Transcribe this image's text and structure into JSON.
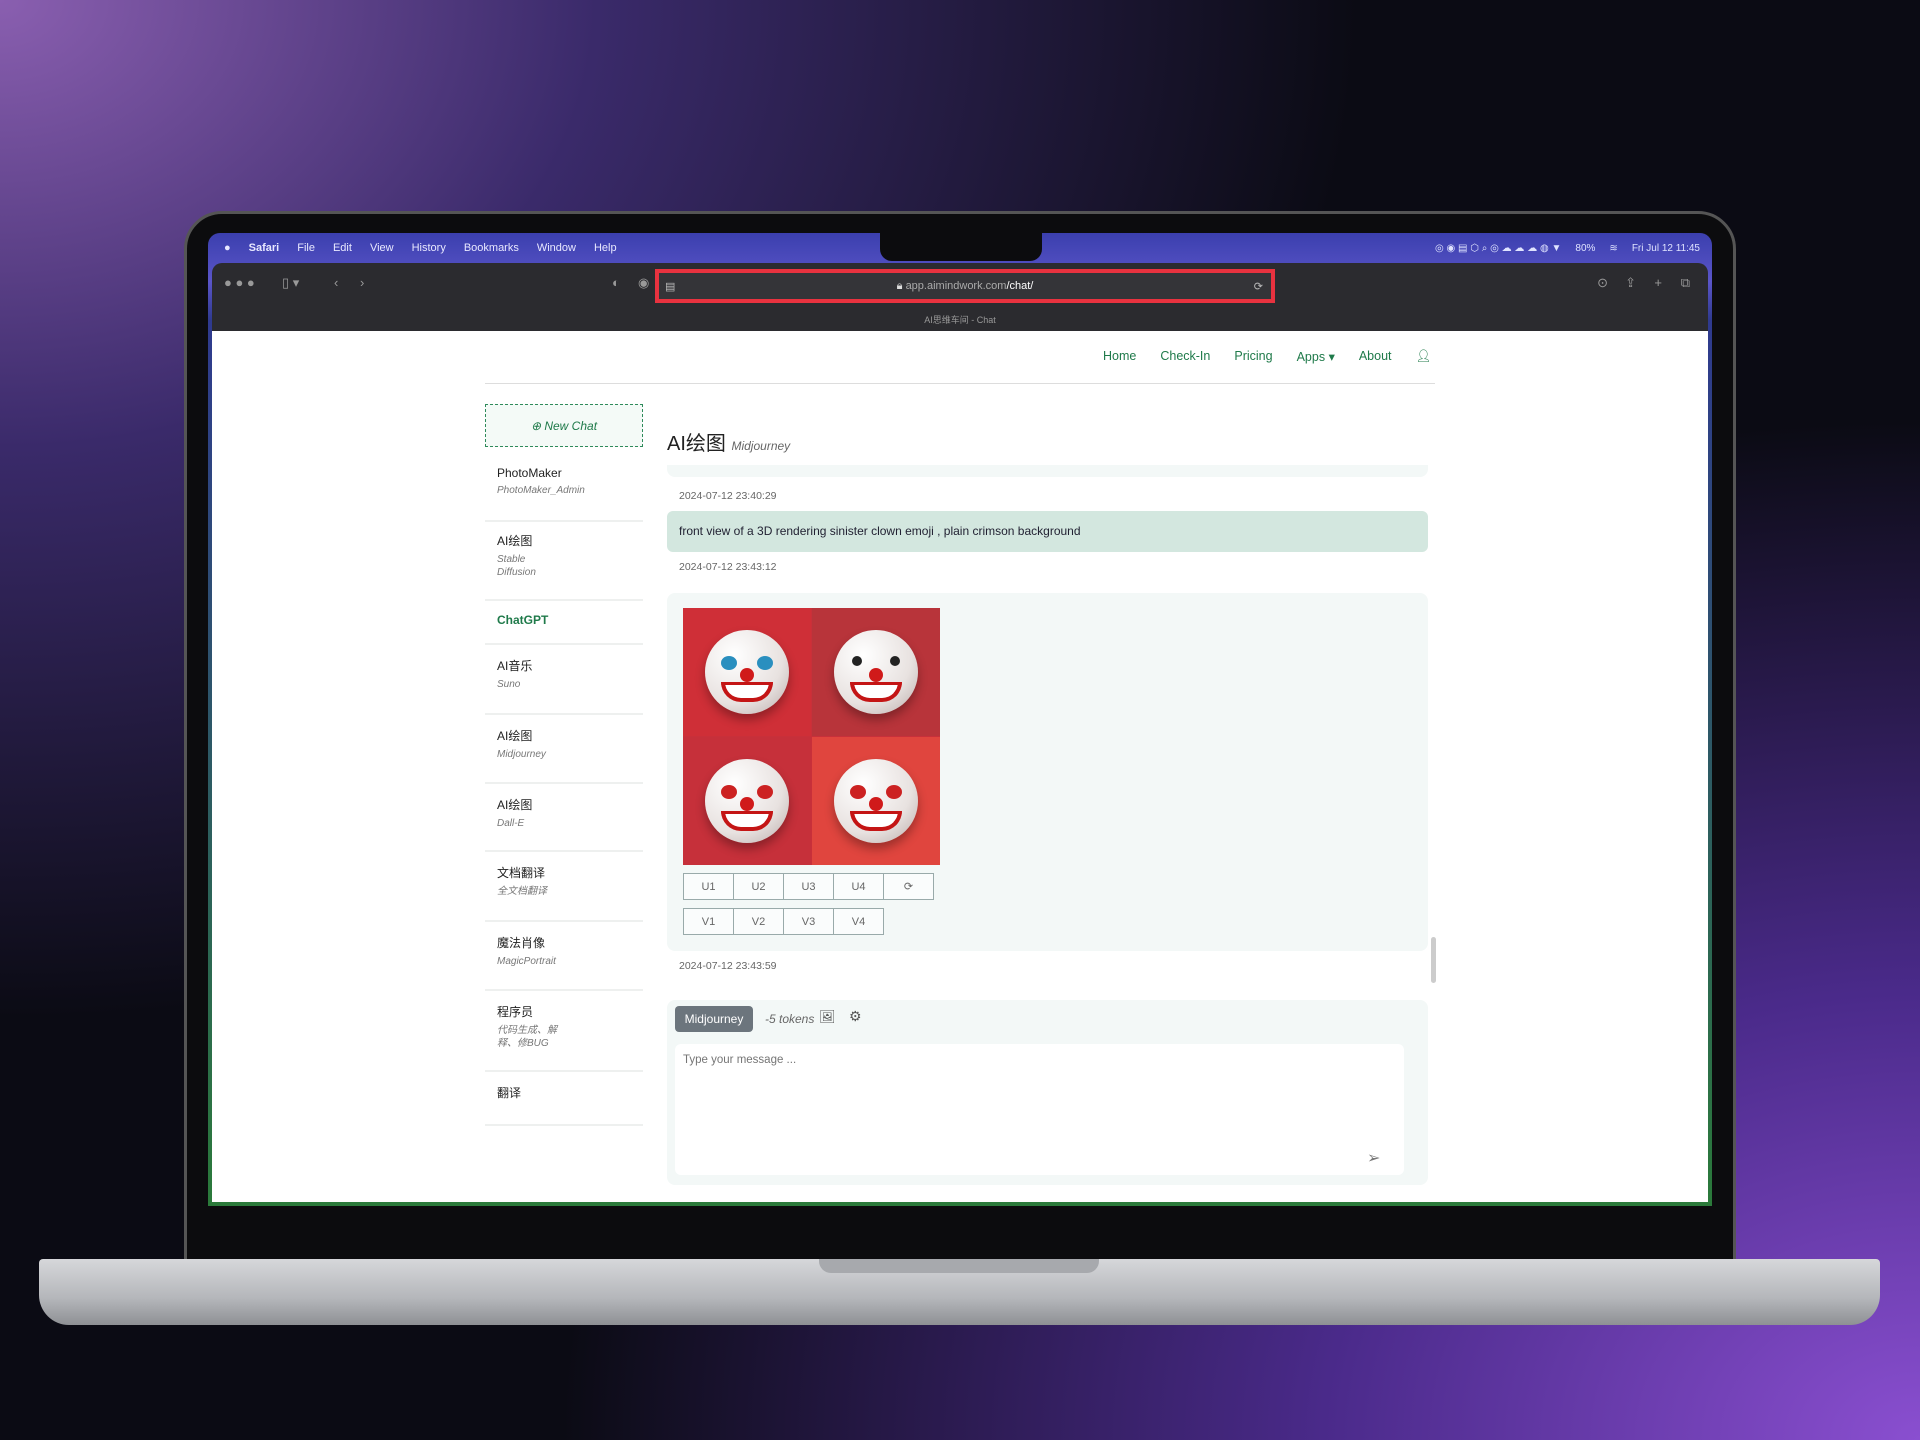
{
  "menubar": {
    "app": "Safari",
    "items": [
      "File",
      "Edit",
      "View",
      "History",
      "Bookmarks",
      "Window",
      "Help"
    ],
    "battery": "80%",
    "clock": "Fri Jul 12  11:45"
  },
  "browser": {
    "url_host": "app.aimindwork.com",
    "url_path": "/chat/",
    "tab_title": "AI思维车间 - Chat"
  },
  "nav": {
    "items": [
      "Home",
      "Check-In",
      "Pricing",
      "Apps",
      "About"
    ]
  },
  "sidebar": {
    "new_chat": "New Chat",
    "items": [
      {
        "title": "PhotoMaker",
        "sub": "PhotoMaker_Admin"
      },
      {
        "title": "AI绘图",
        "sub": "Stable Diffusion"
      },
      {
        "title": "ChatGPT",
        "sub": ""
      },
      {
        "title": "AI音乐",
        "sub": "Suno"
      },
      {
        "title": "AI绘图",
        "sub": "Midjourney"
      },
      {
        "title": "AI绘图",
        "sub": "Dall-E"
      },
      {
        "title": "文档翻译",
        "sub": "全文档翻译"
      },
      {
        "title": "魔法肖像",
        "sub": "MagicPortrait"
      },
      {
        "title": "程序员",
        "sub": "代码生成、解释、修BUG"
      },
      {
        "title": "翻译",
        "sub": ""
      }
    ]
  },
  "chat": {
    "title": "AI绘图",
    "subtitle": "Midjourney",
    "ts1": "2024-07-12 23:40:29",
    "prompt": "front view of a 3D rendering sinister clown emoji , plain crimson background",
    "ts2": "2024-07-12 23:43:12",
    "upscale": [
      "U1",
      "U2",
      "U3",
      "U4"
    ],
    "variation": [
      "V1",
      "V2",
      "V3",
      "V4"
    ],
    "ts3": "2024-07-12 23:43:59"
  },
  "input": {
    "model": "Midjourney",
    "cost": "-5 tokens",
    "placeholder": "Type your message ..."
  },
  "colors": {
    "accent": "#1f7a4a",
    "prompt_bg": "#d3e7df",
    "highlight": "#e8323f"
  }
}
